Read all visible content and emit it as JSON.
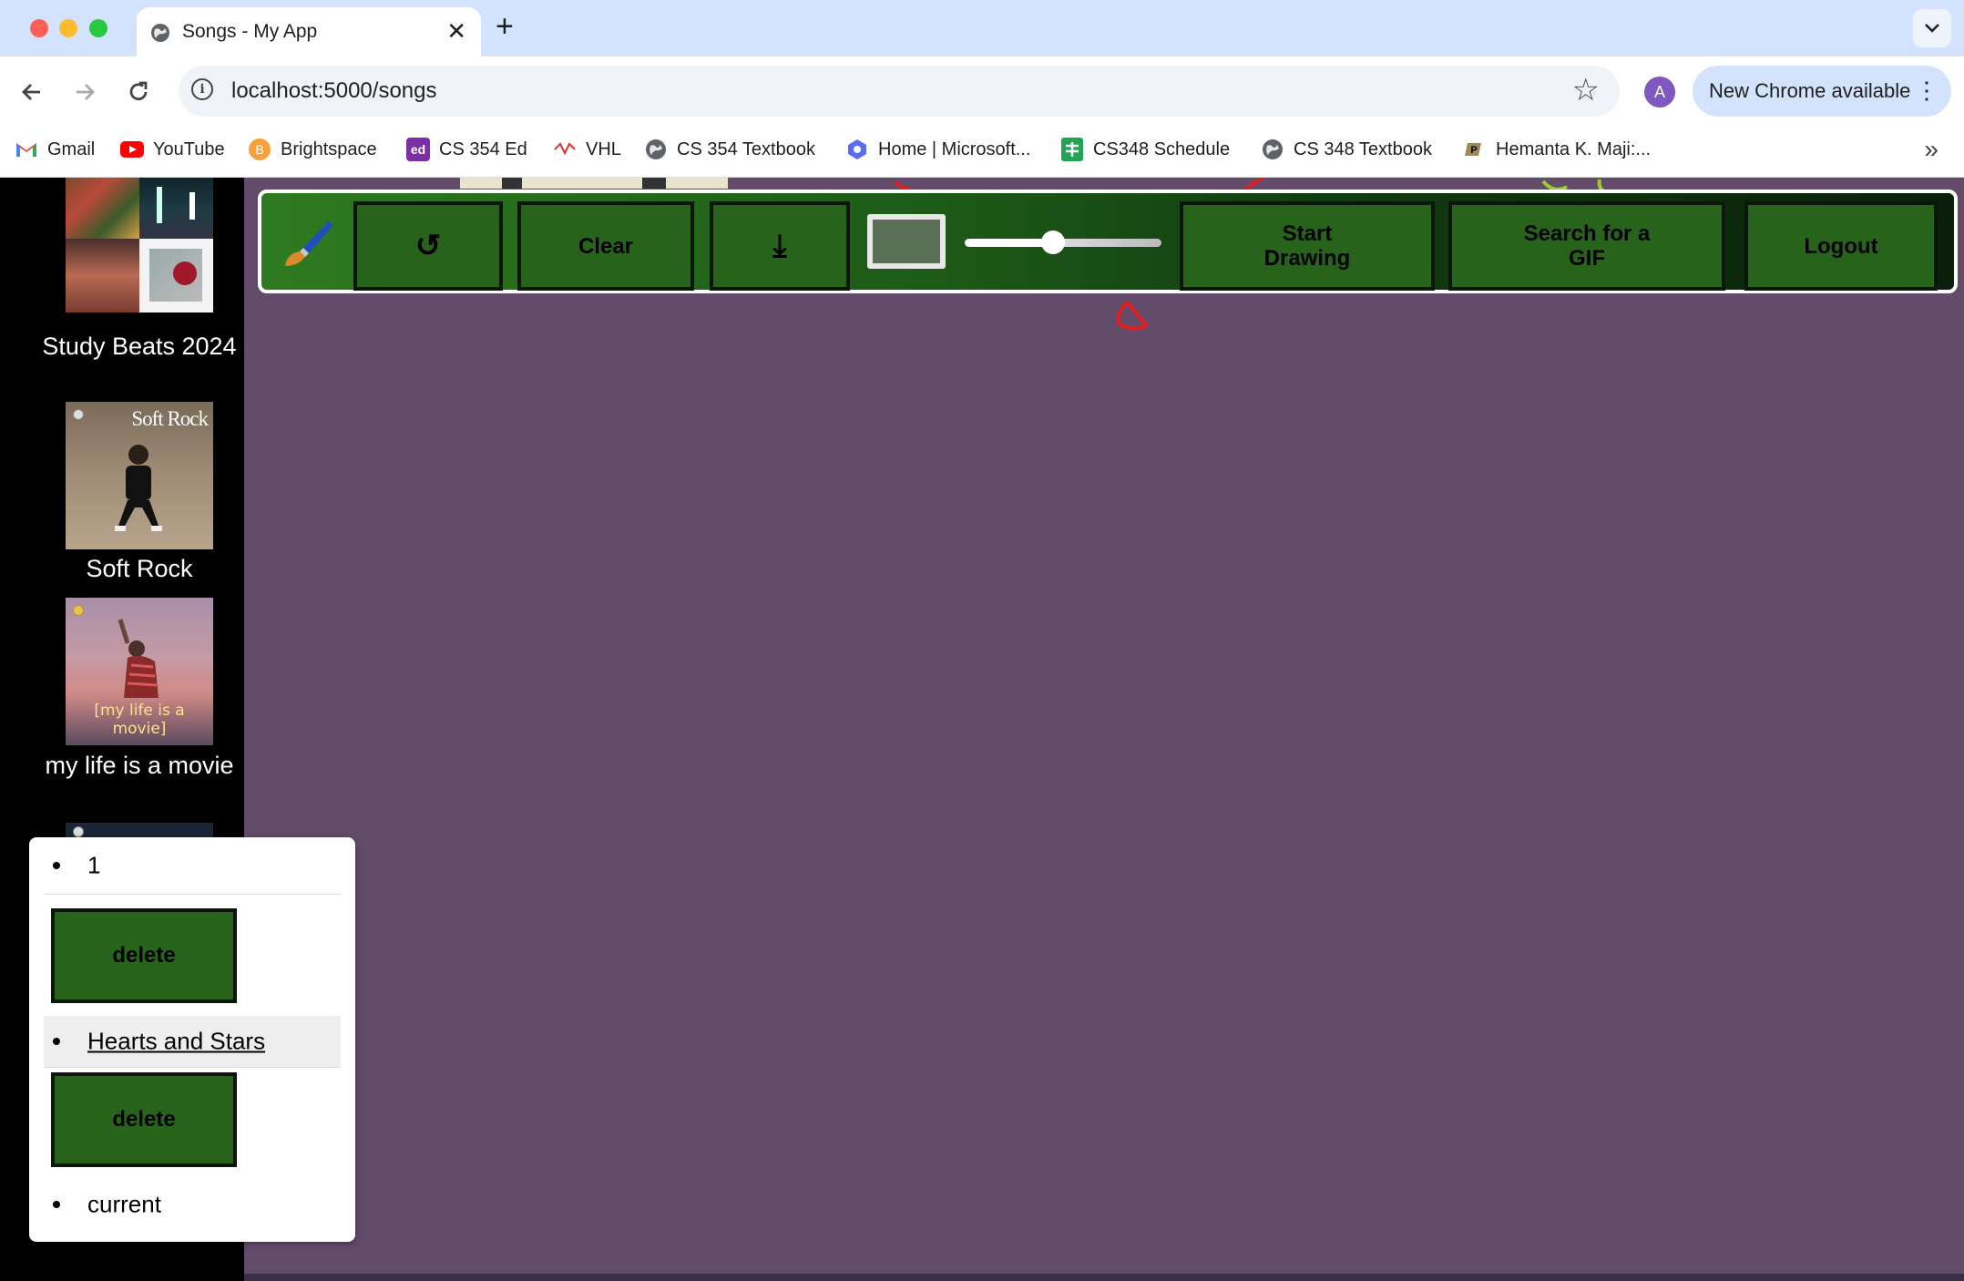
{
  "browser": {
    "tab_title": "Songs - My App",
    "url": "localhost:5000/songs",
    "profile_initial": "A",
    "update_label": "New Chrome available",
    "bookmarks": [
      {
        "label": "Gmail",
        "icon": "gmail-icon"
      },
      {
        "label": "YouTube",
        "icon": "youtube-icon"
      },
      {
        "label": "Brightspace",
        "icon": "brightspace-icon"
      },
      {
        "label": "CS 354 Ed",
        "icon": "ed-icon"
      },
      {
        "label": "VHL",
        "icon": "vhl-icon"
      },
      {
        "label": "CS 354 Textbook",
        "icon": "globe-icon"
      },
      {
        "label": "Home | Microsoft...",
        "icon": "microsoft-icon"
      },
      {
        "label": "CS348 Schedule",
        "icon": "sheets-icon"
      },
      {
        "label": "CS 348 Textbook",
        "icon": "globe-icon"
      },
      {
        "label": "Hemanta K. Maji:...",
        "icon": "purdue-icon"
      }
    ]
  },
  "sidebar": {
    "playlists": [
      {
        "title": "Study Beats 2024"
      },
      {
        "title": "Soft Rock",
        "cover_text": "Soft Rock"
      },
      {
        "title": "my life is a movie",
        "cover_text": "[my life is a movie]"
      }
    ]
  },
  "draw_toolbar": {
    "undo_symbol": "↺",
    "clear_label": "Clear",
    "download_symbol": "⤓",
    "start_drawing_label": "Start Drawing",
    "search_gif_label": "Search for a GIF",
    "logout_label": "Logout",
    "brush_size_fraction": 0.45,
    "color": "#5b6e58"
  },
  "song_list": {
    "items": [
      "1",
      "Hearts and Stars",
      "current"
    ],
    "delete_label": "delete"
  },
  "colors": {
    "accent_green": "#27631b",
    "background_purple": "#634b6a",
    "tab_bar": "#d3e3fd"
  }
}
